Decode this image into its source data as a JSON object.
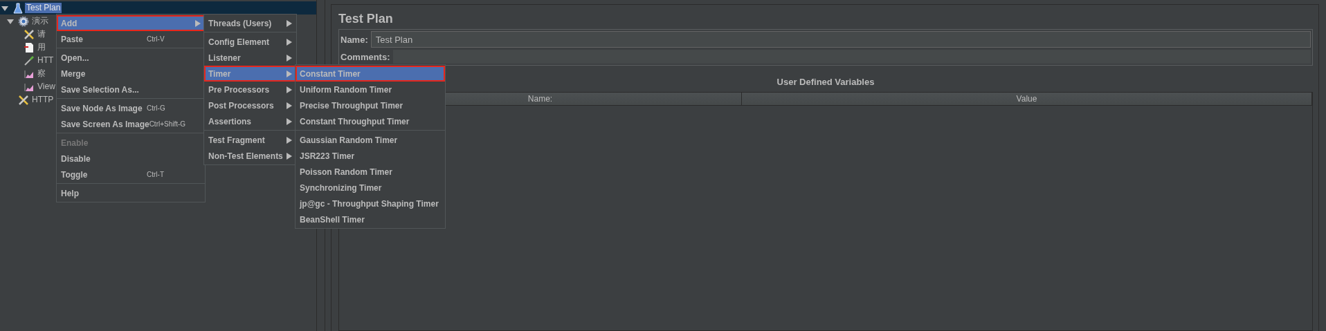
{
  "tree": [
    {
      "label": "Test Plan",
      "kind": "plan",
      "selected": true,
      "expanded": true,
      "children": [
        {
          "label": "演示",
          "kind": "group",
          "selected": false,
          "expanded": true,
          "children": [
            {
              "label": "请",
              "kind": "tool",
              "selected": false
            },
            {
              "label": "用",
              "kind": "doc",
              "selected": false
            },
            {
              "label": "HTT",
              "kind": "dropper",
              "selected": false
            },
            {
              "label": "察",
              "kind": "chart",
              "selected": false
            },
            {
              "label": "View",
              "kind": "chart",
              "selected": false
            }
          ]
        },
        {
          "label": "HTTP",
          "kind": "tool",
          "selected": false
        }
      ]
    }
  ],
  "context_menu": [
    {
      "kind": "item",
      "label": "Add",
      "submenu": true,
      "selected": true,
      "disabled": false,
      "outlined": true
    },
    {
      "kind": "item",
      "label": "Paste",
      "shortcut": "Ctrl-V",
      "selected": false,
      "disabled": false,
      "outlined": false
    },
    {
      "kind": "separator"
    },
    {
      "kind": "item",
      "label": "Open...",
      "selected": false,
      "disabled": false,
      "outlined": false
    },
    {
      "kind": "item",
      "label": "Merge",
      "selected": false,
      "disabled": false,
      "outlined": false
    },
    {
      "kind": "item",
      "label": "Save Selection As...",
      "selected": false,
      "disabled": false,
      "outlined": false
    },
    {
      "kind": "separator"
    },
    {
      "kind": "item",
      "label": "Save Node As Image",
      "shortcut": "Ctrl-G",
      "selected": false,
      "disabled": false,
      "outlined": false
    },
    {
      "kind": "item",
      "label": "Save Screen As Image",
      "shortcut": "Ctrl+Shift-G",
      "selected": false,
      "disabled": false,
      "outlined": false
    },
    {
      "kind": "separator"
    },
    {
      "kind": "item",
      "label": "Enable",
      "selected": false,
      "disabled": true,
      "outlined": false
    },
    {
      "kind": "item",
      "label": "Disable",
      "selected": false,
      "disabled": false,
      "outlined": false
    },
    {
      "kind": "item",
      "label": "Toggle",
      "shortcut": "Ctrl-T",
      "selected": false,
      "disabled": false,
      "outlined": false
    },
    {
      "kind": "separator"
    },
    {
      "kind": "item",
      "label": "Help",
      "selected": false,
      "disabled": false,
      "outlined": false
    }
  ],
  "add_menu": [
    {
      "kind": "item",
      "label": "Threads (Users)",
      "submenu": true,
      "selected": false,
      "outlined": false
    },
    {
      "kind": "separator"
    },
    {
      "kind": "item",
      "label": "Config Element",
      "submenu": true,
      "selected": false,
      "outlined": false
    },
    {
      "kind": "item",
      "label": "Listener",
      "submenu": true,
      "selected": false,
      "outlined": false
    },
    {
      "kind": "item",
      "label": "Timer",
      "submenu": true,
      "selected": true,
      "outlined": true
    },
    {
      "kind": "item",
      "label": "Pre Processors",
      "submenu": true,
      "selected": false,
      "outlined": false
    },
    {
      "kind": "item",
      "label": "Post Processors",
      "submenu": true,
      "selected": false,
      "outlined": false
    },
    {
      "kind": "item",
      "label": "Assertions",
      "submenu": true,
      "selected": false,
      "outlined": false
    },
    {
      "kind": "separator"
    },
    {
      "kind": "item",
      "label": "Test Fragment",
      "submenu": true,
      "selected": false,
      "outlined": false
    },
    {
      "kind": "item",
      "label": "Non-Test Elements",
      "submenu": true,
      "selected": false,
      "outlined": false
    }
  ],
  "timer_menu": [
    {
      "kind": "item",
      "label": "Constant Timer",
      "selected": true,
      "outlined": true
    },
    {
      "kind": "item",
      "label": "Uniform Random Timer",
      "selected": false,
      "outlined": false
    },
    {
      "kind": "item",
      "label": "Precise Throughput Timer",
      "selected": false,
      "outlined": false
    },
    {
      "kind": "item",
      "label": "Constant Throughput Timer",
      "selected": false,
      "outlined": false
    },
    {
      "kind": "separator"
    },
    {
      "kind": "item",
      "label": "Gaussian Random Timer",
      "selected": false,
      "outlined": false
    },
    {
      "kind": "item",
      "label": "JSR223 Timer",
      "selected": false,
      "outlined": false
    },
    {
      "kind": "item",
      "label": "Poisson Random Timer",
      "selected": false,
      "outlined": false
    },
    {
      "kind": "item",
      "label": "Synchronizing Timer",
      "selected": false,
      "outlined": false
    },
    {
      "kind": "item",
      "label": "jp@gc - Throughput Shaping Timer",
      "selected": false,
      "outlined": false
    },
    {
      "kind": "item",
      "label": "BeanShell Timer",
      "selected": false,
      "outlined": false
    }
  ],
  "editor": {
    "title": "Test Plan",
    "name_label": "Name:",
    "name_value": "Test Plan",
    "comments_label": "Comments:",
    "variables": {
      "title": "User Defined Variables",
      "columns": [
        "Name:",
        "Value"
      ]
    }
  }
}
